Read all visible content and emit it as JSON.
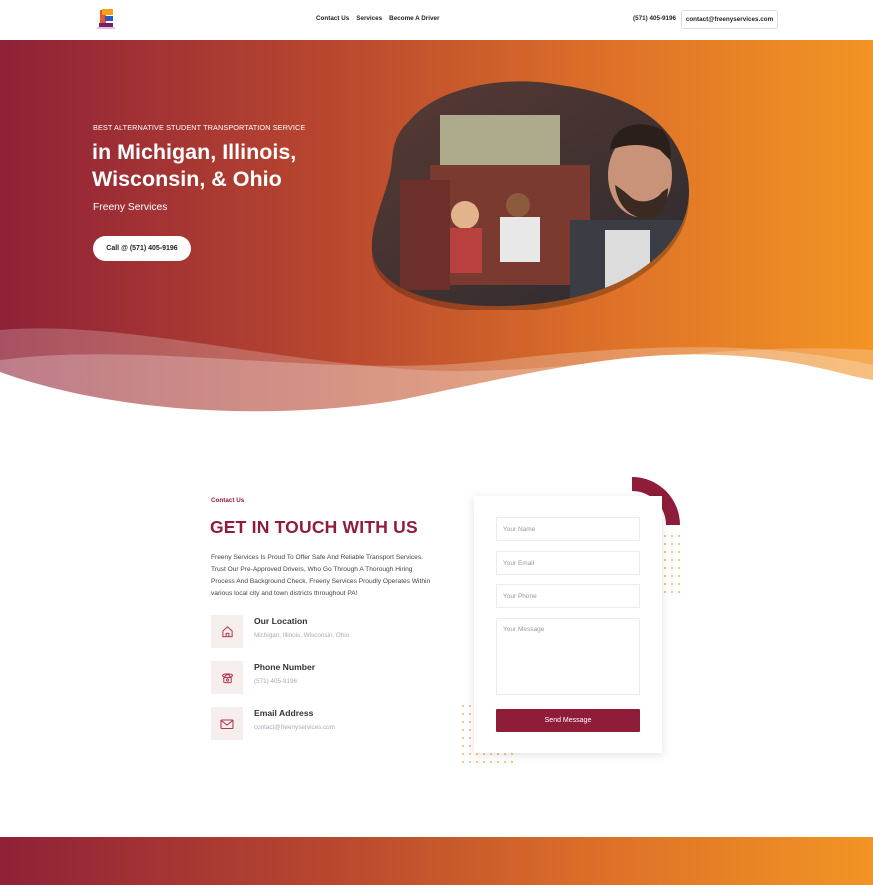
{
  "header": {
    "nav": [
      "Contact Us",
      "Services",
      "Become A Driver"
    ],
    "phone": "(571) 405-9196",
    "email": "contact@freenyservices.com"
  },
  "hero": {
    "kicker": "BEST ALTERNATIVE STUDENT TRANSPORTATION SERVICE",
    "title": "in Michigan, Illinois, Wisconsin, & Ohio",
    "subtitle": "Freeny Services",
    "button": "Call @ (571) 405-9196"
  },
  "contact": {
    "label": "Contact Us",
    "title": "GET IN TOUCH WITH US",
    "description": "Freeny Services Is Proud To Offer Safe And Reliable Transport Services. Trust Our Pre-Approved Drivers, Who Go Through A Thorough Hiring Process And Background Check. Freeny Services Proudly Operates Within various local city and town districts throughout PA!",
    "items": [
      {
        "title": "Our Location",
        "value": "Michigan, Illinois, Wisconsin, Ohio",
        "icon": "home-icon"
      },
      {
        "title": "Phone Number",
        "value": "(571) 405-9196",
        "icon": "phone-icon"
      },
      {
        "title": "Email Address",
        "value": "contact@freenyservices.com",
        "icon": "mail-icon"
      }
    ]
  },
  "form": {
    "name_placeholder": "Your Name",
    "email_placeholder": "Your Email",
    "phone_placeholder": "Your Phone",
    "message_placeholder": "Your Message",
    "submit": "Send Message"
  },
  "colors": {
    "brand": "#8f1d3a",
    "gradient_start": "#8f2138",
    "gradient_end": "#f39424"
  }
}
